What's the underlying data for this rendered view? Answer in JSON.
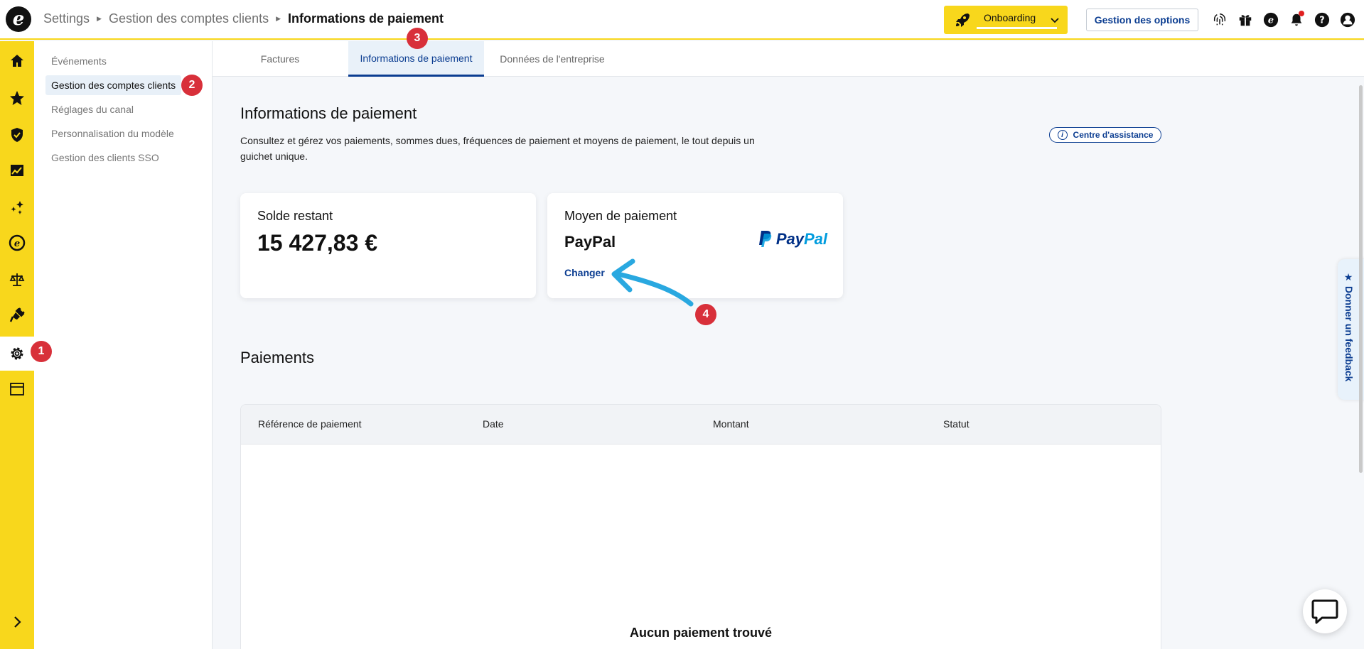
{
  "header": {
    "logo_glyph": "e",
    "breadcrumb": [
      "Settings",
      "Gestion des comptes clients",
      "Informations de paiement"
    ],
    "onboarding_label": "Onboarding",
    "options_button": "Gestion des options",
    "icons": [
      "fingerprint-icon",
      "gift-icon",
      "brand-e-icon",
      "bell-icon",
      "help-icon",
      "user-icon"
    ]
  },
  "rail": {
    "icons": [
      "home-icon",
      "star-icon",
      "shield-icon",
      "chart-icon",
      "sparkles-icon",
      "brand-e-icon",
      "scale-icon",
      "plug-icon",
      "gear-icon",
      "window-icon"
    ],
    "expand_icon": "chevron-right-icon"
  },
  "subnav": {
    "items": [
      {
        "label": "Événements"
      },
      {
        "label": "Gestion des comptes clients"
      },
      {
        "label": "Réglages du canal"
      },
      {
        "label": "Personnalisation du modèle"
      },
      {
        "label": "Gestion des clients SSO"
      }
    ]
  },
  "tabs": [
    {
      "label": "Factures"
    },
    {
      "label": "Informations de paiement"
    },
    {
      "label": "Données de l'entreprise"
    }
  ],
  "main": {
    "title": "Informations de paiement",
    "description": "Consultez et gérez vos paiements, sommes dues, fréquences de paiement et moyens de paiement, le tout depuis un guichet unique.",
    "help_button": "Centre d'assistance",
    "help_icon_glyph": "i"
  },
  "balance_card": {
    "title": "Solde restant",
    "amount": "15 427,83 €"
  },
  "payment_card": {
    "title": "Moyen de paiement",
    "method": "PayPal",
    "change_link": "Changer",
    "logo_text_pay": "Pay",
    "logo_text_pal": "Pal"
  },
  "payments": {
    "title": "Paiements",
    "columns": [
      "Référence de paiement",
      "Date",
      "Montant",
      "Statut"
    ],
    "empty_message": "Aucun paiement trouvé"
  },
  "feedback_tab": "★ Donner un feedback",
  "badges": [
    "1",
    "2",
    "3",
    "4"
  ],
  "colors": {
    "accent_yellow": "#f8d71c",
    "primary_blue": "#0b3d91",
    "badge_red": "#d8303a",
    "annotation_arrow": "#29a8e0"
  }
}
